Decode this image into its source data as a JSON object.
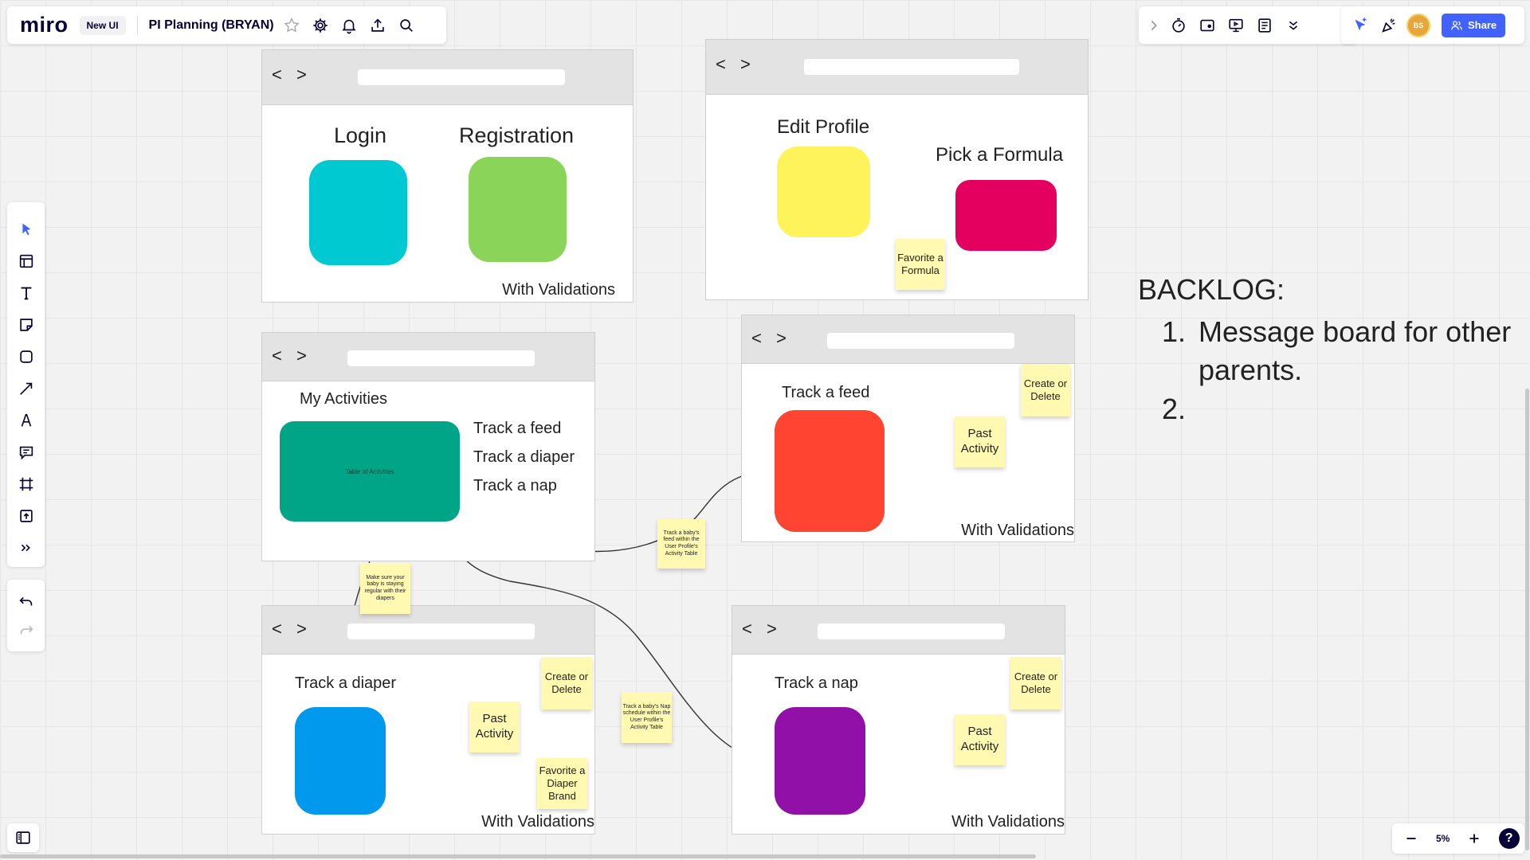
{
  "topbar": {
    "logo": "miro",
    "new_ui_badge": "New UI",
    "board_title": "PI Planning (BRYAN)",
    "share_label": "Share",
    "avatar_initials": "BS"
  },
  "zoom": {
    "level": "5%"
  },
  "frames": {
    "login": {
      "label_login": "Login",
      "label_registration": "Registration",
      "validations": "With Validations"
    },
    "profile": {
      "label_edit": "Edit Profile",
      "label_formula": "Pick a Formula"
    },
    "activities": {
      "title": "My Activities",
      "table_label": "Table of Activities",
      "item1": "Track a feed",
      "item2": "Track a diaper",
      "item3": "Track a nap"
    },
    "feed": {
      "title": "Track a feed",
      "validations": "With Validations"
    },
    "diaper": {
      "title": "Track a diaper",
      "validations": "With Validations"
    },
    "nap": {
      "title": "Track a nap",
      "validations": "With Validations"
    }
  },
  "stickies": {
    "favorite_formula": "Favorite a Formula",
    "feed_create": "Create or Delete",
    "feed_past": "Past Activity",
    "feed_note": "Track a baby's feed within the User Profile's Activity Table",
    "diaper_note": "Make sure your baby is staying regular with their diapers",
    "diaper_create": "Create or Delete",
    "diaper_past": "Past Activity",
    "diaper_favorite": "Favorite a Diaper Brand",
    "nap_note": "Track a baby's Nap schedule within the User Profile's Activity Table",
    "nap_create": "Create or Delete",
    "nap_past": "Past Activity"
  },
  "backlog": {
    "title": "BACKLOG:",
    "items": [
      "Message board for other parents.",
      ""
    ]
  },
  "colors": {
    "login": "#00c9d2",
    "registration": "#8bd45a",
    "edit_profile": "#fff35c",
    "formula": "#e3005f",
    "activities": "#00a587",
    "feed": "#ff4431",
    "diaper": "#0099ee",
    "nap": "#9111a8",
    "accent": "#4262ff"
  }
}
